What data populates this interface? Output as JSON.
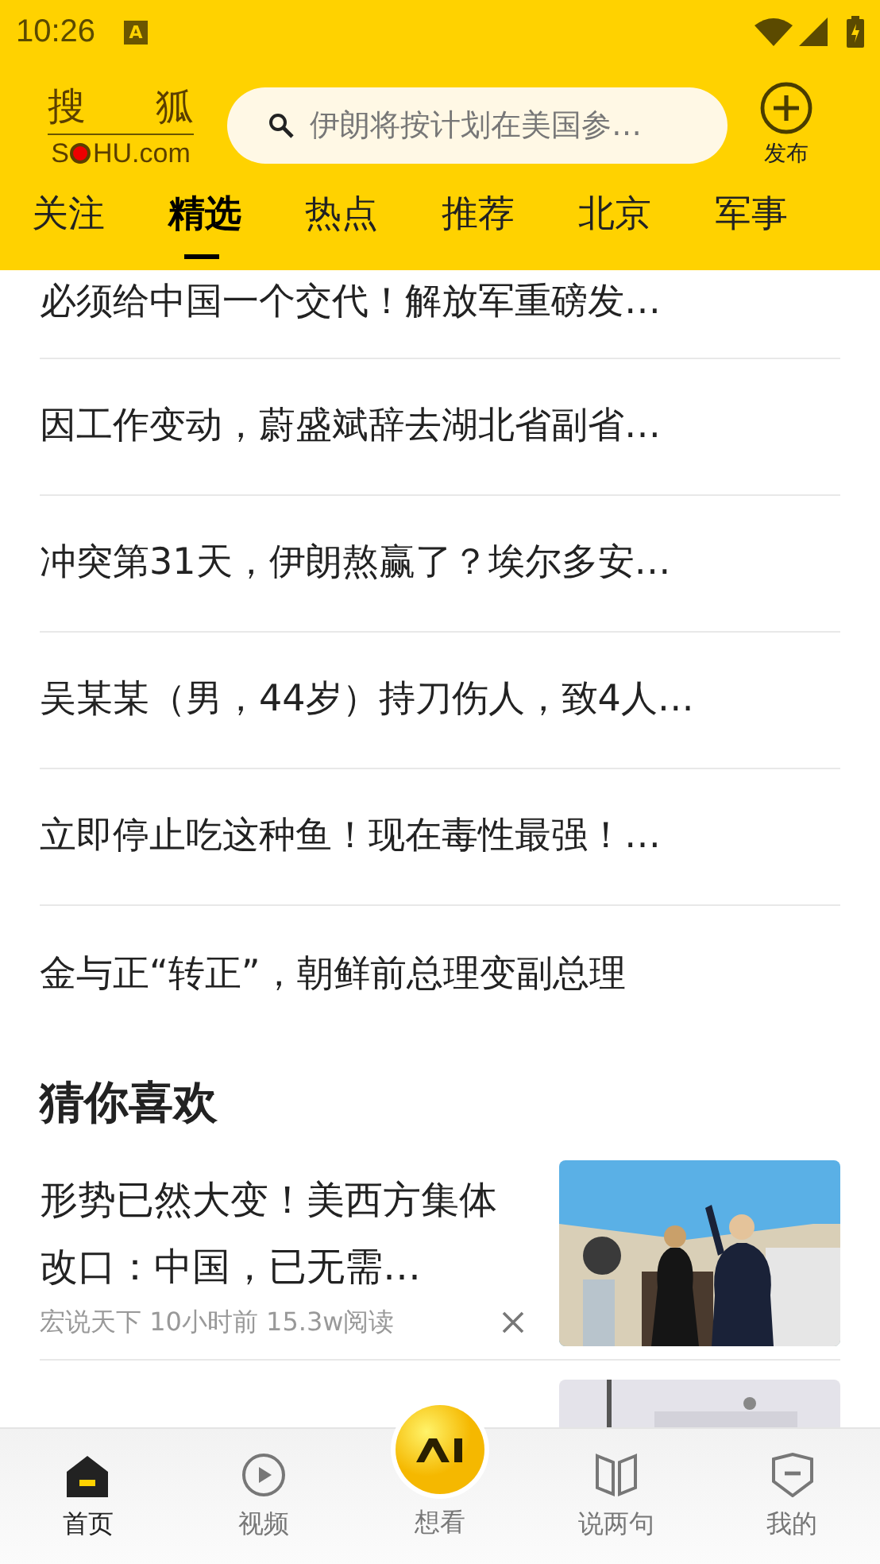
{
  "status_bar": {
    "time": "10:26",
    "notification": "A"
  },
  "header": {
    "logo": {
      "top_left": "搜",
      "top_right": "狐",
      "prefix": "S",
      "suffix": "HU.com"
    },
    "search": {
      "placeholder": "伊朗将按计划在美国参…"
    },
    "publish": {
      "label": "发布"
    }
  },
  "tabs": [
    {
      "label": "关注",
      "selected": false
    },
    {
      "label": "精选",
      "selected": true
    },
    {
      "label": "热点",
      "selected": false
    },
    {
      "label": "推荐",
      "selected": false
    },
    {
      "label": "北京",
      "selected": false
    },
    {
      "label": "军事",
      "selected": false
    }
  ],
  "headlines": [
    {
      "title": "必须给中国一个交代！解放军重磅发…"
    },
    {
      "title": "因工作变动，蔚盛斌辞去湖北省副省…"
    },
    {
      "title": "冲突第31天，伊朗熬赢了？埃尔多安…"
    },
    {
      "title": "吴某某（男，44岁）持刀伤人，致4人…"
    },
    {
      "title": "立即停止吃这种鱼！现在毒性最强！…"
    },
    {
      "title": "金与正“转正”，朝鲜前总理变副总理"
    }
  ],
  "section_title": "猜你喜欢",
  "articles": [
    {
      "title": "形势已然大变！美西方集体改口：中国，已无需…",
      "source": "宏说天下",
      "time": "10小时前",
      "reads": "15.3w阅读",
      "kind": "picture"
    },
    {
      "kind": "picture"
    }
  ],
  "bottom_nav": [
    {
      "label": "首页",
      "selected": true,
      "kind": "home"
    },
    {
      "label": "视频",
      "selected": false,
      "kind": "video"
    },
    {
      "label": "想看",
      "selected": false,
      "kind": "ai"
    },
    {
      "label": "说两句",
      "selected": false,
      "kind": "comment"
    },
    {
      "label": "我的",
      "selected": false,
      "kind": "profile"
    }
  ]
}
